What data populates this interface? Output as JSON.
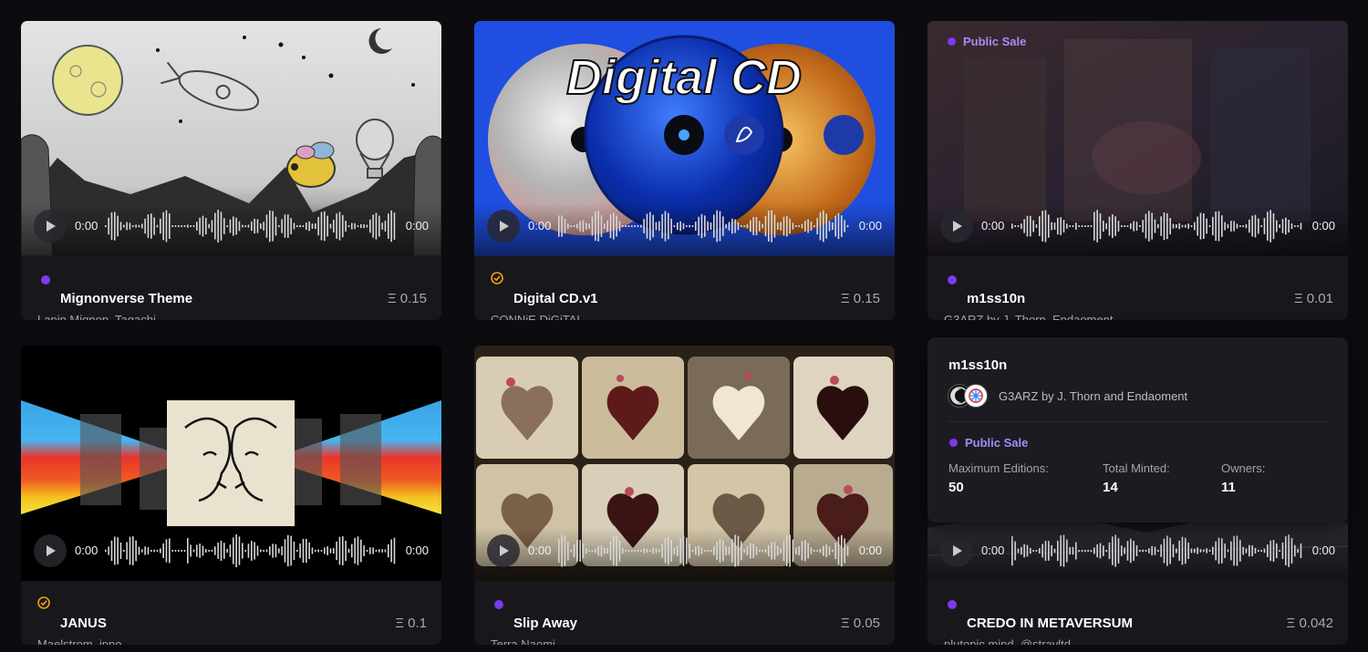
{
  "cards": [
    {
      "title": "Mignonverse Theme",
      "artist": "Lapin Mignon, Tagachi",
      "price": "Ξ 0.15",
      "status_icon": "purple-dot",
      "time_start": "0:00",
      "time_end": "0:00"
    },
    {
      "title": "Digital CD.v1",
      "artist": "CONNiE DiGiTAL",
      "price": "Ξ 0.15",
      "status_icon": "orange-check",
      "time_start": "0:00",
      "time_end": "0:00",
      "art_text": "Digital CD"
    },
    {
      "title": "m1ss10n",
      "artist": "G3ARZ by J. Thorn, Endaoment",
      "price": "Ξ 0.01",
      "status_icon": "purple-dot",
      "time_start": "0:00",
      "time_end": "0:00",
      "badge": "Public Sale"
    },
    {
      "title": "JANUS",
      "artist": "Maelstrom, ipno",
      "price": "Ξ 0.1",
      "status_icon": "orange-check",
      "time_start": "0:00",
      "time_end": "0:00"
    },
    {
      "title": "Slip Away",
      "artist": "Terra Naomi",
      "price": "Ξ 0.05",
      "status_icon": "purple-dot",
      "time_start": "0:00",
      "time_end": "0:00"
    },
    {
      "title": "CREDO IN METAVERSUM",
      "artist": "plutonic mind, @strayltd",
      "price": "Ξ 0.042",
      "status_icon": "purple-dot",
      "time_start": "0:00",
      "time_end": "0:00"
    }
  ],
  "popup": {
    "title": "m1ss10n",
    "artist": "G3ARZ by J. Thorn and Endaoment",
    "sale_status": "Public Sale",
    "stats": [
      {
        "label": "Maximum Editions:",
        "value": "50"
      },
      {
        "label": "Total Minted:",
        "value": "14"
      },
      {
        "label": "Owners:",
        "value": "11"
      }
    ]
  },
  "colors": {
    "accent": "#7c3aed",
    "badge_text": "#a78bfa",
    "check": "#f59e0b",
    "card_bg": "#17171c",
    "page_bg": "#0c0c10"
  }
}
